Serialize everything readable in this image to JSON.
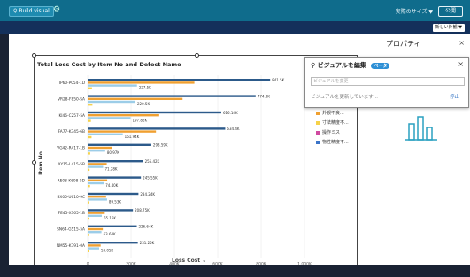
{
  "topbar": {
    "build_visual_label": "Build visual",
    "size_label": "実際のサイズ ▼",
    "apply_label": "公開"
  },
  "subbar": {
    "new_label": "新しい外観 ▼"
  },
  "properties": {
    "title": "プロパティ"
  },
  "edit_panel": {
    "title": "ビジュアルを編集",
    "badge": "ベータ",
    "placeholder": "ビジュアルを変更",
    "status": "ビジュアルを更新しています...",
    "stop_label": "停止"
  },
  "legend": {
    "items": [
      {
        "label": "外観不良...",
        "color": "#f0a030"
      },
      {
        "label": "寸法精度不...",
        "color": "#f6d24a"
      },
      {
        "label": "操作ミス",
        "color": "#d04aa0"
      },
      {
        "label": "物性精度不...",
        "color": "#3b74c8"
      }
    ]
  },
  "chart_data": {
    "type": "bar",
    "title": "Total Loss Cost by Item No and Defect Name",
    "xlabel": "Loss Cost",
    "ylabel": "Item No",
    "xlim": [
      0,
      1000000
    ],
    "xticks": [
      "0",
      "200K",
      "400K",
      "600K",
      "800K",
      "1,000K"
    ],
    "categories": [
      "IP60-P054-1D",
      "VR28-F850-SA",
      "KI46-C257-5A",
      "FA77-K345-6B",
      "VG42-R417-1B",
      "XY15-L415-5B",
      "RE08-K608-5D",
      "BX05-U610-9C",
      "FE45-X365-1B",
      "SN64-G515-5A",
      "NM55-K791-0A"
    ],
    "series": [
      {
        "name": "物性精度不...",
        "color": "#2c5a8a",
        "values": [
          841500,
          774800,
          616140,
          634400,
          293590,
          255420,
          245550,
          234240,
          208750,
          226640,
          231250
        ]
      },
      {
        "name": "外観不良...",
        "color": "#f0a030",
        "values": [
          492240,
          437700,
          330000,
          315000,
          113000,
          88000,
          90000,
          85000,
          79000,
          70000,
          60000
        ]
      },
      {
        "name": "寸法精度不...",
        "color": "#9ccde8",
        "values": [
          227500,
          220500,
          197820,
          161940,
          80970,
          71280,
          74400,
          89530,
          65150,
          63640,
          53050
        ]
      },
      {
        "name": "操作ミス",
        "color": "#f6d24a",
        "values": [
          20000,
          22000,
          15000,
          18000,
          12000,
          9000,
          11000,
          8000,
          7000,
          6000,
          5000
        ]
      }
    ],
    "data_labels": [
      "841.5K",
      "227.5K",
      "774.8K",
      "220.5K",
      "616.14K",
      "197.82K",
      "634.4K",
      "161.94K",
      "293.59K",
      "80.97K",
      "255.42K",
      "71.28K",
      "245.55K",
      "74.40K",
      "234.24K",
      "89.53K",
      "208.75K",
      "65.15K",
      "226.64K",
      "63.64K",
      "231.25K",
      "53.05K"
    ]
  }
}
